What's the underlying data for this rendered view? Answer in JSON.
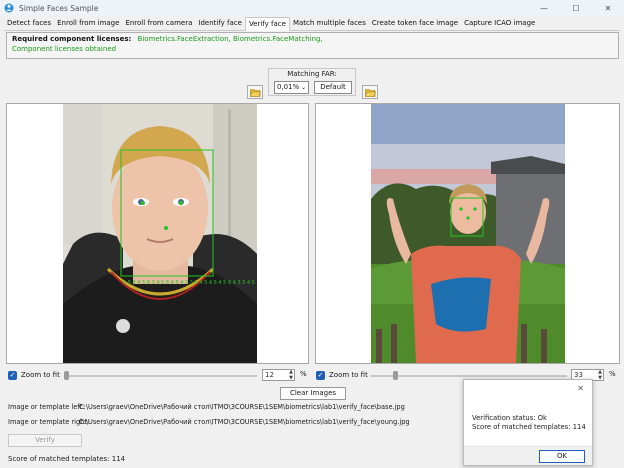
{
  "window": {
    "title": "Simple Faces Sample",
    "minimize_glyph": "—",
    "maximize_glyph": "☐",
    "close_glyph": "✕"
  },
  "tabs": [
    {
      "label": "Detect faces",
      "active": false
    },
    {
      "label": "Enroll from image",
      "active": false
    },
    {
      "label": "Enroll from camera",
      "active": false
    },
    {
      "label": "Identify face",
      "active": false
    },
    {
      "label": "Verify face",
      "active": true
    },
    {
      "label": "Match multiple faces",
      "active": false
    },
    {
      "label": "Create token face image",
      "active": false
    },
    {
      "label": "Capture ICAO image",
      "active": false
    }
  ],
  "license": {
    "label": "Required component licenses:",
    "value": "Biometrics.FaceExtraction, Biometrics.FaceMatching,",
    "status": "Component licenses obtained"
  },
  "matching": {
    "label": "Matching FAR:",
    "value": "0,01%",
    "default_label": "Default"
  },
  "left_panel": {
    "zoom_label": "Zoom to fit",
    "zoom_value": "12",
    "zoom_unit": "%",
    "face_label": "1 5 6 4 5 8 3 4 5 6 4 5 4 2 3 5 4 5 4 5 4 5 6 4 3 5 4 5 4"
  },
  "right_panel": {
    "zoom_label": "Zoom to fit",
    "zoom_value": "33",
    "zoom_unit": "%"
  },
  "clear_label": "Clear Images",
  "paths": {
    "left_label": "Image or template left:",
    "left_value": "C:\\Users\\graev\\OneDrive\\Рабочий стол\\ITMO\\3COURSE\\1SEM\\biometrics\\lab1\\verify_face\\base.jpg",
    "right_label": "Image or template right:",
    "right_value": "C:\\Users\\graev\\OneDrive\\Рабочий стол\\ITMO\\3COURSE\\1SEM\\biometrics\\lab1\\verify_face\\young.jpg"
  },
  "verify_label": "Verify",
  "score_status": "Score of matched templates: 114",
  "dialog": {
    "status": "Verification status: Ok",
    "score": "Score of matched templates: 114",
    "ok_label": "OK",
    "close_glyph": "✕"
  },
  "colors": {
    "accent": "#1f5fb8",
    "license_green": "#1a9a1a",
    "face_box": "#22c522"
  }
}
